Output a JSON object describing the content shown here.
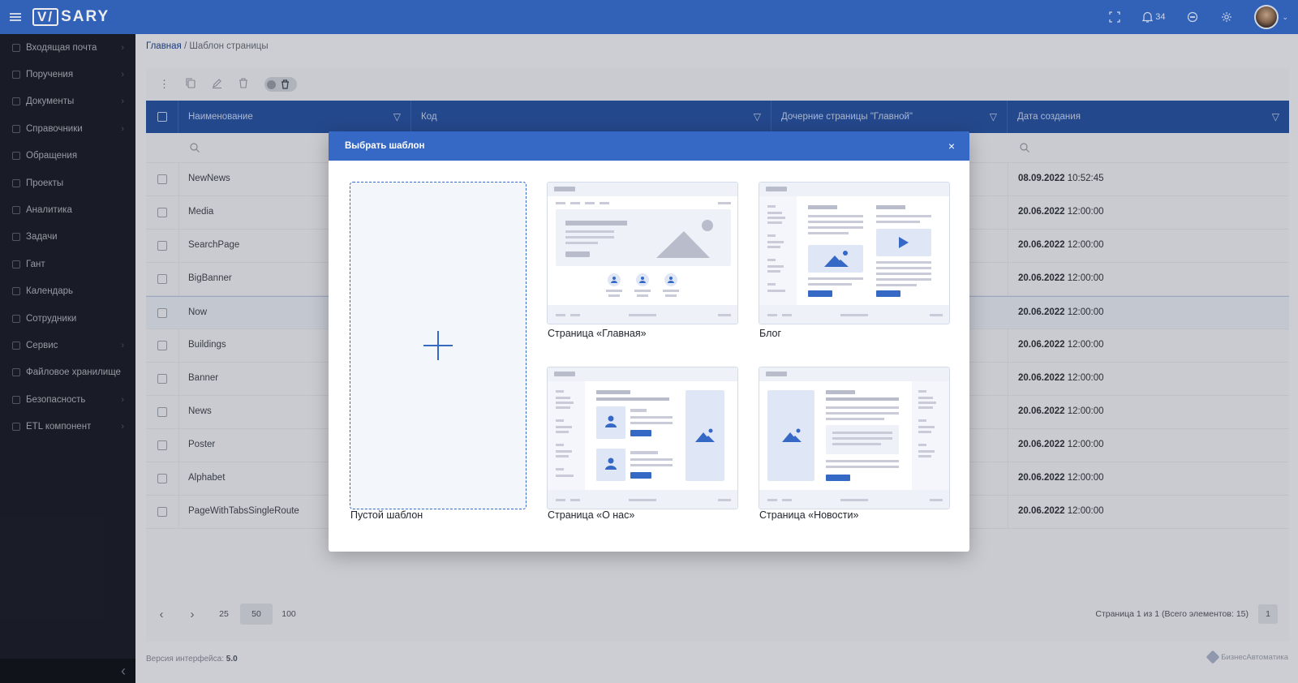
{
  "app": {
    "logo": "VISARY",
    "logo_v": "V/",
    "logo_rest": "SARY",
    "notifications_count": "34"
  },
  "breadcrumb": {
    "home": "Главная",
    "separator": " / ",
    "current": "Шаблон страницы"
  },
  "sidebar": {
    "items": [
      {
        "label": "Входящая почта",
        "chevron": true
      },
      {
        "label": "Поручения",
        "chevron": true
      },
      {
        "label": "Документы",
        "chevron": true
      },
      {
        "label": "Справочники",
        "chevron": true
      },
      {
        "label": "Обращения",
        "chevron": false
      },
      {
        "label": "Проекты",
        "chevron": false
      },
      {
        "label": "Аналитика",
        "chevron": false
      },
      {
        "label": "Задачи",
        "chevron": false
      },
      {
        "label": "Гант",
        "chevron": false
      },
      {
        "label": "Календарь",
        "chevron": false
      },
      {
        "label": "Сотрудники",
        "chevron": false
      },
      {
        "label": "Сервис",
        "chevron": true
      },
      {
        "label": "Файловое хранилище",
        "chevron": false
      },
      {
        "label": "Безопасность",
        "chevron": true
      },
      {
        "label": "ETL компонент",
        "chevron": true
      }
    ]
  },
  "table": {
    "columns": [
      "Наименование",
      "Код",
      "Дочерние страницы \"Главной\"",
      "Дата создания"
    ],
    "rows": [
      {
        "name": "NewNews",
        "date": "08.09.2022",
        "time": "10:52:45"
      },
      {
        "name": "Media",
        "date": "20.06.2022",
        "time": "12:00:00"
      },
      {
        "name": "SearchPage",
        "date": "20.06.2022",
        "time": "12:00:00"
      },
      {
        "name": "BigBanner",
        "date": "20.06.2022",
        "time": "12:00:00"
      },
      {
        "name": "Now",
        "date": "20.06.2022",
        "time": "12:00:00"
      },
      {
        "name": "Buildings",
        "date": "20.06.2022",
        "time": "12:00:00"
      },
      {
        "name": "Banner",
        "date": "20.06.2022",
        "time": "12:00:00"
      },
      {
        "name": "News",
        "date": "20.06.2022",
        "time": "12:00:00"
      },
      {
        "name": "Poster",
        "date": "20.06.2022",
        "time": "12:00:00"
      },
      {
        "name": "Alphabet",
        "date": "20.06.2022",
        "time": "12:00:00"
      },
      {
        "name": "PageWithTabsSingleRoute",
        "date": "20.06.2022",
        "time": "12:00:00"
      }
    ]
  },
  "pager": {
    "sizes": [
      "25",
      "50",
      "100"
    ],
    "active_size": "50",
    "info": "Страница 1 из 1 (Всего элементов: 15)",
    "page": "1"
  },
  "footer": {
    "version_label": "Версия интерфейса:",
    "version": "5.0",
    "brand": "БизнесАвтоматика"
  },
  "modal": {
    "title": "Выбрать шаблон",
    "close": "×",
    "templates": [
      {
        "label": "Пустой шаблон"
      },
      {
        "label": "Страница «Главная»"
      },
      {
        "label": "Блог"
      },
      {
        "label": "Страница «О нас»"
      },
      {
        "label": "Страница «Новости»"
      }
    ]
  },
  "colors": {
    "accent": "#3569c5",
    "header_dark": "#254c95",
    "sidebar": "#1a1d28",
    "placeholder": "#b9bccb",
    "placeholder_blue": "#3569c5"
  }
}
